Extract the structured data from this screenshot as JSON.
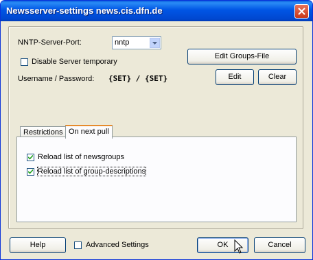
{
  "window": {
    "title": "Newsserver-settings news.cis.dfn.de"
  },
  "server": {
    "port_label": "NNTP-Server-Port:",
    "port_value": "nntp",
    "disable_label": "Disable Server temporary",
    "disable_checked": false,
    "edit_groups_label": "Edit Groups-File",
    "credentials_label": "Username / Password:",
    "credentials_value": "{SET} / {SET}",
    "edit_label": "Edit",
    "clear_label": "Clear"
  },
  "tabs": [
    {
      "label": "Restrictions",
      "active": false
    },
    {
      "label": "On next pull",
      "active": true
    }
  ],
  "pull": {
    "reload_groups_label": "Reload list of newsgroups",
    "reload_groups_checked": true,
    "reload_desc_label": "Reload list of group-descriptions",
    "reload_desc_checked": true
  },
  "footer": {
    "help_label": "Help",
    "advanced_label": "Advanced Settings",
    "advanced_checked": false,
    "ok_label": "OK",
    "cancel_label": "Cancel"
  }
}
